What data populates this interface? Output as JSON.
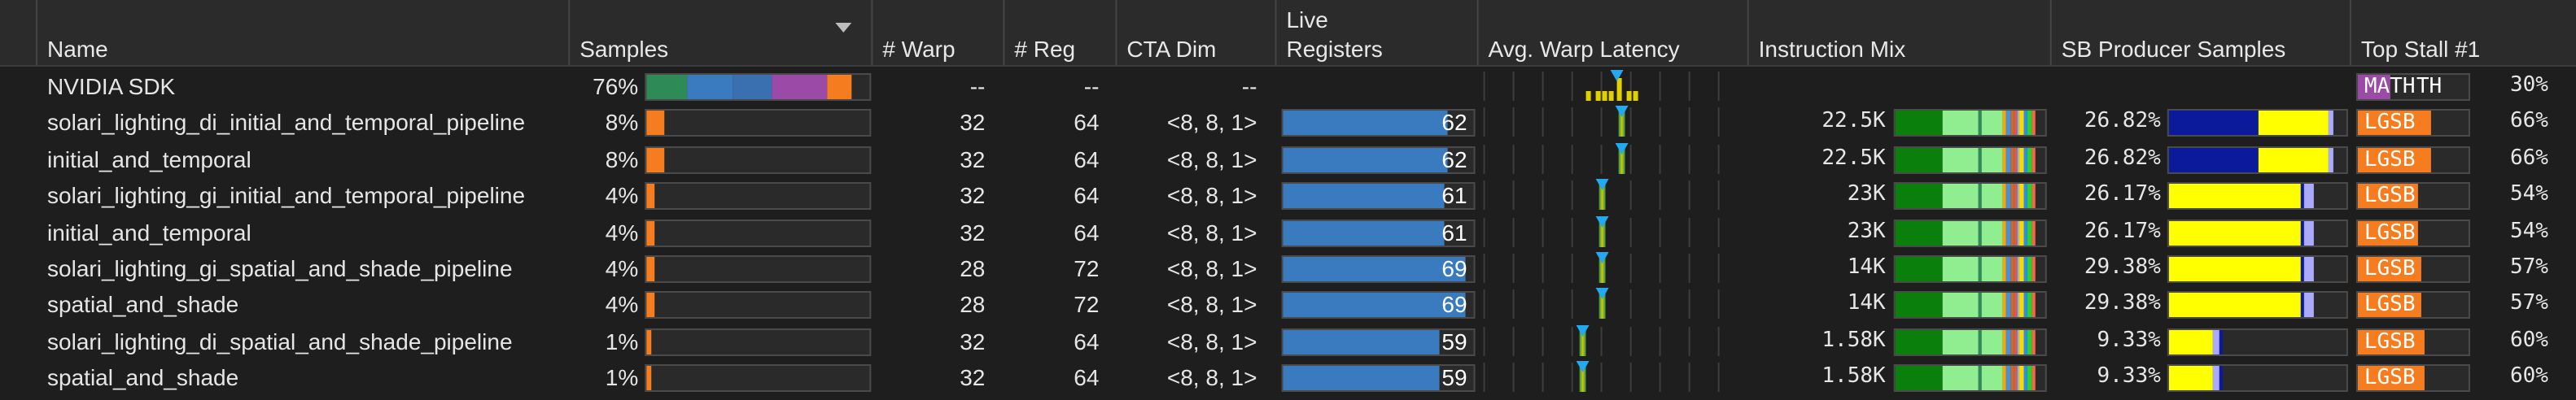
{
  "header": {
    "name": "Name",
    "samples": "Samples",
    "warp": "# Warp",
    "reg": "# Reg",
    "cta": "CTA Dim",
    "live1": "Live",
    "live2": "Registers",
    "latency": "Avg. Warp Latency",
    "mix": "Instruction Mix",
    "sb": "SB Producer Samples",
    "stall": "Top Stall #1"
  },
  "colors": {
    "orange": "#f57c1f",
    "blue_reg": "#3a7bc0",
    "dark_green": "#0b7f0b",
    "light_green": "#90ee90",
    "navy": "#0a1a9a",
    "yellow": "#ffff00",
    "purple": "#9b4aa8",
    "latency_marker": "#24a8f0"
  },
  "rows": [
    {
      "name": "NVIDIA SDK",
      "samples": "76%",
      "samples_pct": 0.76,
      "warp": "--",
      "reg": "--",
      "cta": "--",
      "live": "",
      "live_frac": 0,
      "mix": "",
      "sb": "",
      "stall": "MATH",
      "stall_pct": "30%",
      "stall_frac": 0.3,
      "stall_color": "#9b4aa8",
      "lat_pos": 0.56,
      "top": true,
      "stall_tail": "TH"
    },
    {
      "name": "solari_lighting_di_initial_and_temporal_pipeline",
      "samples": "8%",
      "samples_pct": 0.08,
      "warp": "32",
      "reg": "64",
      "cta": "<8, 8, 1>",
      "live": "62",
      "live_frac": 0.86,
      "mix": "22.5K",
      "sb": "26.82%",
      "sb_kind": "navy",
      "stall": "LGSB",
      "stall_pct": "66%",
      "stall_frac": 0.66,
      "stall_color": "#f57c1f",
      "lat_pos": 0.58
    },
    {
      "name": "initial_and_temporal",
      "samples": "8%",
      "samples_pct": 0.08,
      "warp": "32",
      "reg": "64",
      "cta": "<8, 8, 1>",
      "live": "62",
      "live_frac": 0.86,
      "mix": "22.5K",
      "sb": "26.82%",
      "sb_kind": "navy",
      "stall": "LGSB",
      "stall_pct": "66%",
      "stall_frac": 0.66,
      "stall_color": "#f57c1f",
      "lat_pos": 0.58
    },
    {
      "name": "solari_lighting_gi_initial_and_temporal_pipeline",
      "samples": "4%",
      "samples_pct": 0.04,
      "warp": "32",
      "reg": "64",
      "cta": "<8, 8, 1>",
      "live": "61",
      "live_frac": 0.85,
      "mix": "23K",
      "sb": "26.17%",
      "sb_kind": "yellow",
      "stall": "LGSB",
      "stall_pct": "54%",
      "stall_frac": 0.54,
      "stall_color": "#f57c1f",
      "lat_pos": 0.5
    },
    {
      "name": "initial_and_temporal",
      "samples": "4%",
      "samples_pct": 0.04,
      "warp": "32",
      "reg": "64",
      "cta": "<8, 8, 1>",
      "live": "61",
      "live_frac": 0.85,
      "mix": "23K",
      "sb": "26.17%",
      "sb_kind": "yellow",
      "stall": "LGSB",
      "stall_pct": "54%",
      "stall_frac": 0.54,
      "stall_color": "#f57c1f",
      "lat_pos": 0.5
    },
    {
      "name": "solari_lighting_gi_spatial_and_shade_pipeline",
      "samples": "4%",
      "samples_pct": 0.04,
      "warp": "28",
      "reg": "72",
      "cta": "<8, 8, 1>",
      "live": "69",
      "live_frac": 0.96,
      "mix": "14K",
      "sb": "29.38%",
      "sb_kind": "yellow",
      "stall": "LGSB",
      "stall_pct": "57%",
      "stall_frac": 0.57,
      "stall_color": "#f57c1f",
      "lat_pos": 0.5
    },
    {
      "name": "spatial_and_shade",
      "samples": "4%",
      "samples_pct": 0.04,
      "warp": "28",
      "reg": "72",
      "cta": "<8, 8, 1>",
      "live": "69",
      "live_frac": 0.96,
      "mix": "14K",
      "sb": "29.38%",
      "sb_kind": "yellow",
      "stall": "LGSB",
      "stall_pct": "57%",
      "stall_frac": 0.57,
      "stall_color": "#f57c1f",
      "lat_pos": 0.5
    },
    {
      "name": "solari_lighting_di_spatial_and_shade_pipeline",
      "samples": "1%",
      "samples_pct": 0.01,
      "warp": "32",
      "reg": "64",
      "cta": "<8, 8, 1>",
      "live": "59",
      "live_frac": 0.82,
      "mix": "1.58K",
      "sb": "9.33%",
      "sb_kind": "yellow_small",
      "stall": "LGSB",
      "stall_pct": "60%",
      "stall_frac": 0.6,
      "stall_color": "#f57c1f",
      "lat_pos": 0.42
    },
    {
      "name": "spatial_and_shade",
      "samples": "1%",
      "samples_pct": 0.01,
      "warp": "32",
      "reg": "64",
      "cta": "<8, 8, 1>",
      "live": "59",
      "live_frac": 0.82,
      "mix": "1.58K",
      "sb": "9.33%",
      "sb_kind": "yellow_small",
      "stall": "LGSB",
      "stall_pct": "60%",
      "stall_frac": 0.6,
      "stall_color": "#f57c1f",
      "lat_pos": 0.42
    }
  ]
}
